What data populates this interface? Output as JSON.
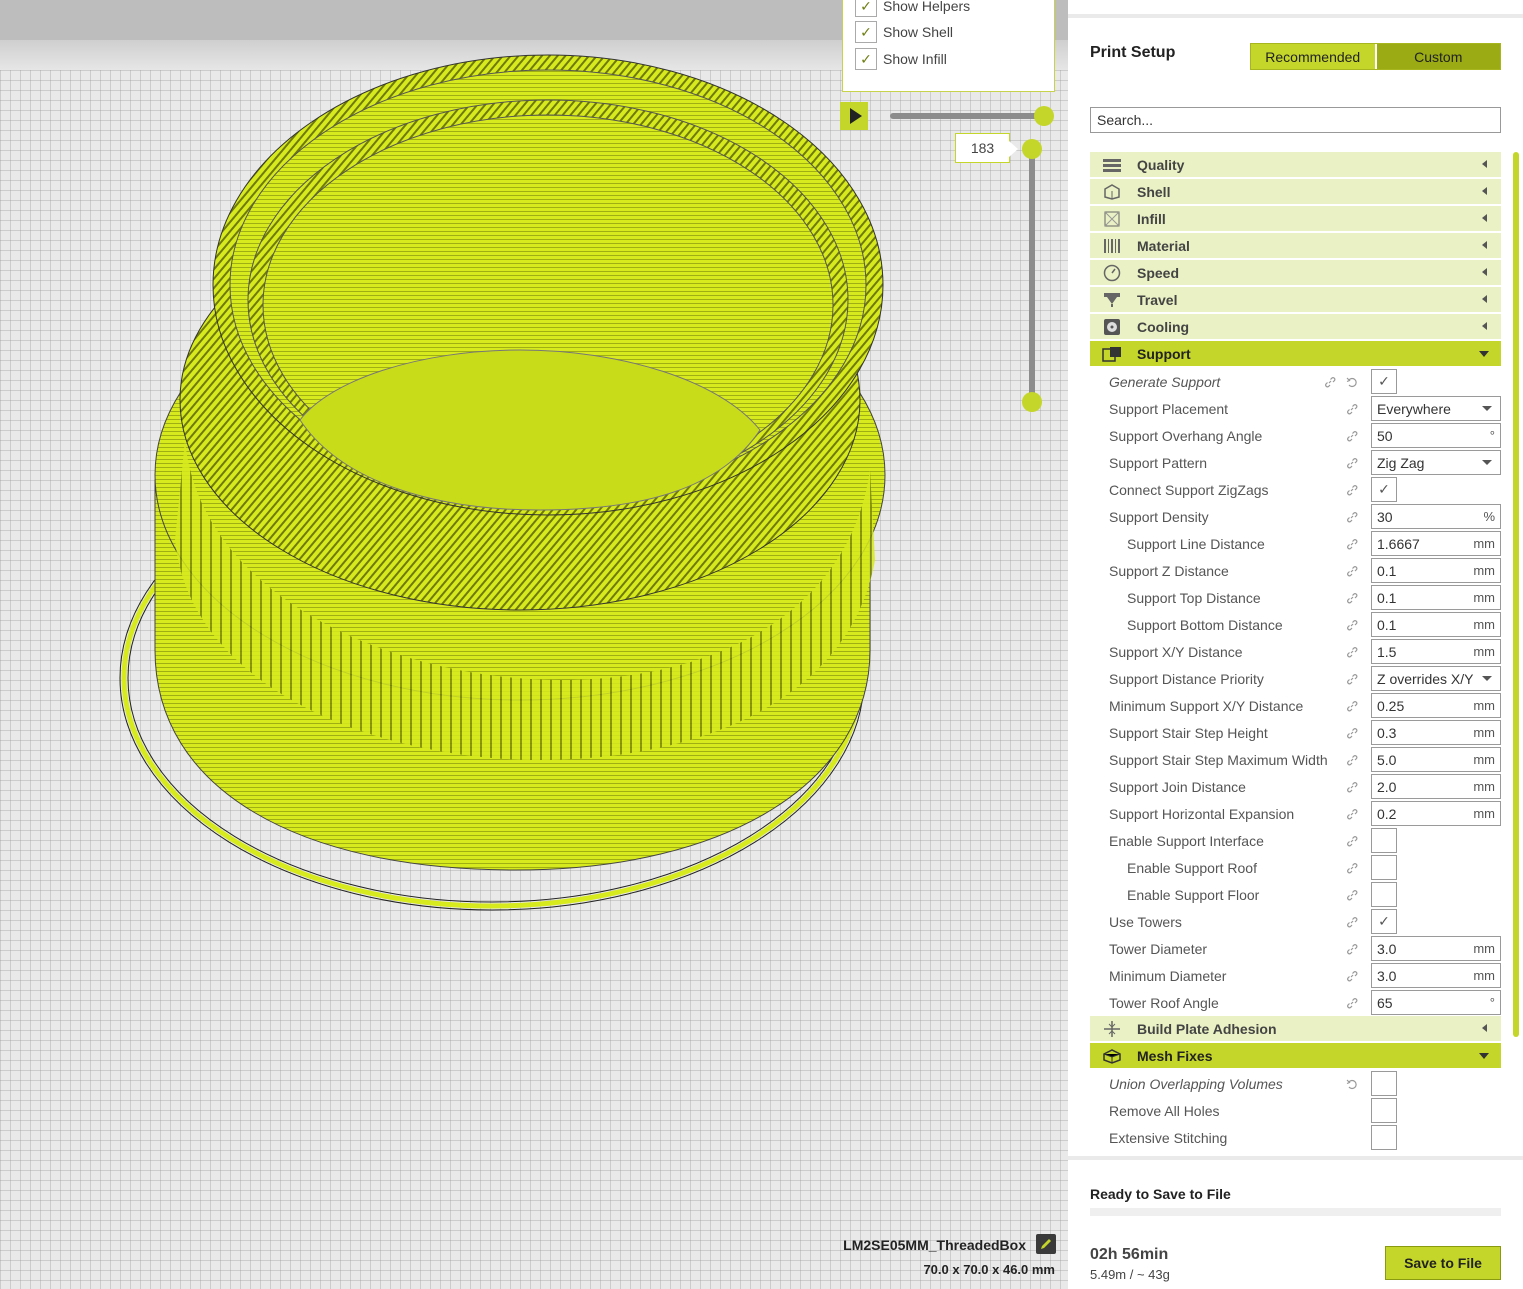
{
  "view_options": {
    "items": [
      {
        "label": "Show Helpers",
        "checked": true
      },
      {
        "label": "Show Shell",
        "checked": true
      },
      {
        "label": "Show Infill",
        "checked": true
      }
    ]
  },
  "layer_slider": {
    "current_layer": "183"
  },
  "job": {
    "name": "LM2SE05MM_ThreadedBox",
    "dimensions": "70.0 x 70.0 x 46.0 mm"
  },
  "sidebar": {
    "title": "Print Setup",
    "modes": {
      "recommended": "Recommended",
      "custom": "Custom",
      "active": "Custom"
    },
    "search_placeholder": "Search...",
    "categories_before": [
      {
        "label": "Quality",
        "icon": "quality-icon"
      },
      {
        "label": "Shell",
        "icon": "shell-icon"
      },
      {
        "label": "Infill",
        "icon": "infill-icon"
      },
      {
        "label": "Material",
        "icon": "material-icon"
      },
      {
        "label": "Speed",
        "icon": "speed-icon"
      },
      {
        "label": "Travel",
        "icon": "travel-icon"
      },
      {
        "label": "Cooling",
        "icon": "cooling-icon"
      }
    ],
    "support": {
      "label": "Support",
      "settings": [
        {
          "label": "Generate Support",
          "type": "check",
          "checked": true
        },
        {
          "label": "Support Placement",
          "type": "select",
          "value": "Everywhere"
        },
        {
          "label": "Support Overhang Angle",
          "type": "value",
          "value": "50",
          "unit": "°"
        },
        {
          "label": "Support Pattern",
          "type": "select",
          "value": "Zig Zag"
        },
        {
          "label": "Connect Support ZigZags",
          "type": "check",
          "checked": true
        },
        {
          "label": "Support Density",
          "type": "value",
          "value": "30",
          "unit": "%"
        },
        {
          "label": "Support Line Distance",
          "type": "value",
          "value": "1.6667",
          "unit": "mm"
        },
        {
          "label": "Support Z Distance",
          "type": "value",
          "value": "0.1",
          "unit": "mm"
        },
        {
          "label": "Support Top Distance",
          "type": "value",
          "value": "0.1",
          "unit": "mm"
        },
        {
          "label": "Support Bottom Distance",
          "type": "value",
          "value": "0.1",
          "unit": "mm"
        },
        {
          "label": "Support X/Y Distance",
          "type": "value",
          "value": "1.5",
          "unit": "mm"
        },
        {
          "label": "Support Distance Priority",
          "type": "select",
          "value": "Z overrides X/Y"
        },
        {
          "label": "Minimum Support X/Y Distance",
          "type": "value",
          "value": "0.25",
          "unit": "mm"
        },
        {
          "label": "Support Stair Step Height",
          "type": "value",
          "value": "0.3",
          "unit": "mm"
        },
        {
          "label": "Support Stair Step Maximum Width",
          "type": "value",
          "value": "5.0",
          "unit": "mm"
        },
        {
          "label": "Support Join Distance",
          "type": "value",
          "value": "2.0",
          "unit": "mm"
        },
        {
          "label": "Support Horizontal Expansion",
          "type": "value",
          "value": "0.2",
          "unit": "mm"
        },
        {
          "label": "Enable Support Interface",
          "type": "check",
          "checked": false
        },
        {
          "label": "Enable Support Roof",
          "type": "check",
          "checked": false
        },
        {
          "label": "Enable Support Floor",
          "type": "check",
          "checked": false
        },
        {
          "label": "Use Towers",
          "type": "check",
          "checked": true
        },
        {
          "label": "Tower Diameter",
          "type": "value",
          "value": "3.0",
          "unit": "mm"
        },
        {
          "label": "Minimum Diameter",
          "type": "value",
          "value": "3.0",
          "unit": "mm"
        },
        {
          "label": "Tower Roof Angle",
          "type": "value",
          "value": "65",
          "unit": "°"
        }
      ]
    },
    "build_plate": {
      "label": "Build Plate Adhesion",
      "icon": "build-plate-adhesion-icon"
    },
    "mesh_fixes": {
      "label": "Mesh Fixes",
      "settings": [
        {
          "label": "Union Overlapping Volumes",
          "type": "check",
          "checked": false
        },
        {
          "label": "Remove All Holes",
          "type": "check",
          "checked": false
        },
        {
          "label": "Extensive Stitching",
          "type": "check",
          "checked": false
        }
      ]
    }
  },
  "status": {
    "ready": "Ready to Save to File",
    "time": "02h 56min",
    "material": "5.49m / ~ 43g",
    "save_button": "Save to File"
  },
  "colors": {
    "accent": "#c4d62a",
    "accent_dark": "#9aab13",
    "model": "#d9ec1f"
  }
}
